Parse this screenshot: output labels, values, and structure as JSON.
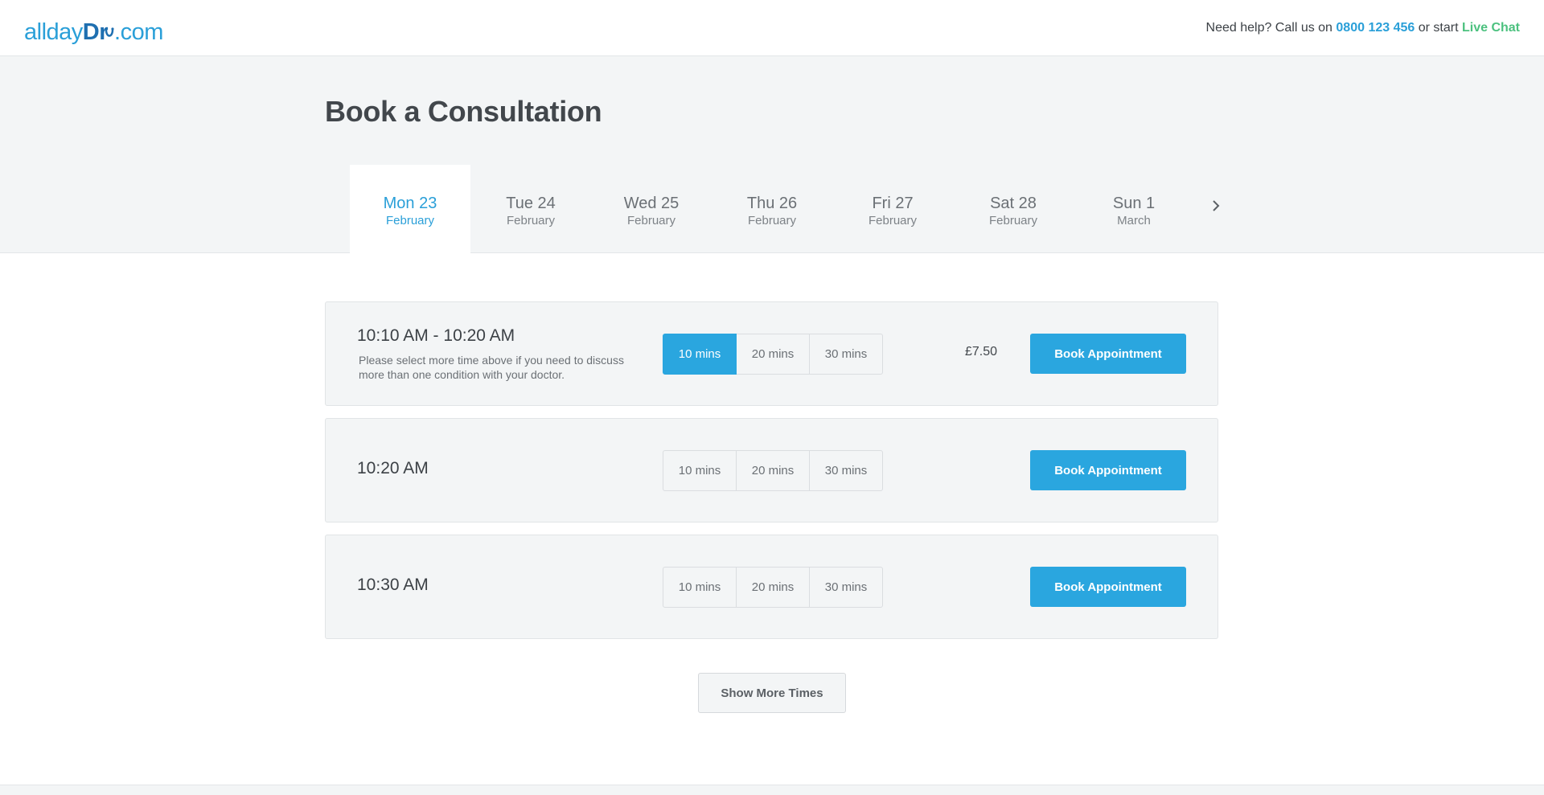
{
  "header": {
    "logo": {
      "part1": "allday",
      "part2": "Dr",
      "part3": ".com"
    },
    "help_prefix": "Need help? Call us on",
    "phone": "0800 123 456",
    "help_middle": "or start",
    "chat": "Live Chat"
  },
  "page": {
    "title": "Book a Consultation"
  },
  "days": [
    {
      "day": "Mon 23",
      "month": "February",
      "active": true
    },
    {
      "day": "Tue 24",
      "month": "February",
      "active": false
    },
    {
      "day": "Wed 25",
      "month": "February",
      "active": false
    },
    {
      "day": "Thu 26",
      "month": "February",
      "active": false
    },
    {
      "day": "Fri 27",
      "month": "February",
      "active": false
    },
    {
      "day": "Sat 28",
      "month": "February",
      "active": false
    },
    {
      "day": "Sun 1",
      "month": "March",
      "active": false
    }
  ],
  "slots": [
    {
      "time": "10:10 AM - 10:20 AM",
      "note": "Please select more time above if you need to discuss more than one condition with your doctor.",
      "durations": [
        "10 mins",
        "20 mins",
        "30 mins"
      ],
      "selected_duration": "10 mins",
      "price": "£7.50",
      "book_label": "Book Appointment"
    },
    {
      "time": "10:20 AM",
      "durations": [
        "10 mins",
        "20 mins",
        "30 mins"
      ],
      "book_label": "Book Appointment"
    },
    {
      "time": "10:30 AM",
      "durations": [
        "10 mins",
        "20 mins",
        "30 mins"
      ],
      "book_label": "Book Appointment"
    }
  ],
  "show_more_label": "Show More Times",
  "icons": {
    "next": "chevron-right-icon",
    "logo_stethoscope": "stethoscope-icon"
  },
  "colors": {
    "brand_blue": "#2aa6df",
    "chat_green": "#4cc17f",
    "background": "#f3f5f6"
  }
}
